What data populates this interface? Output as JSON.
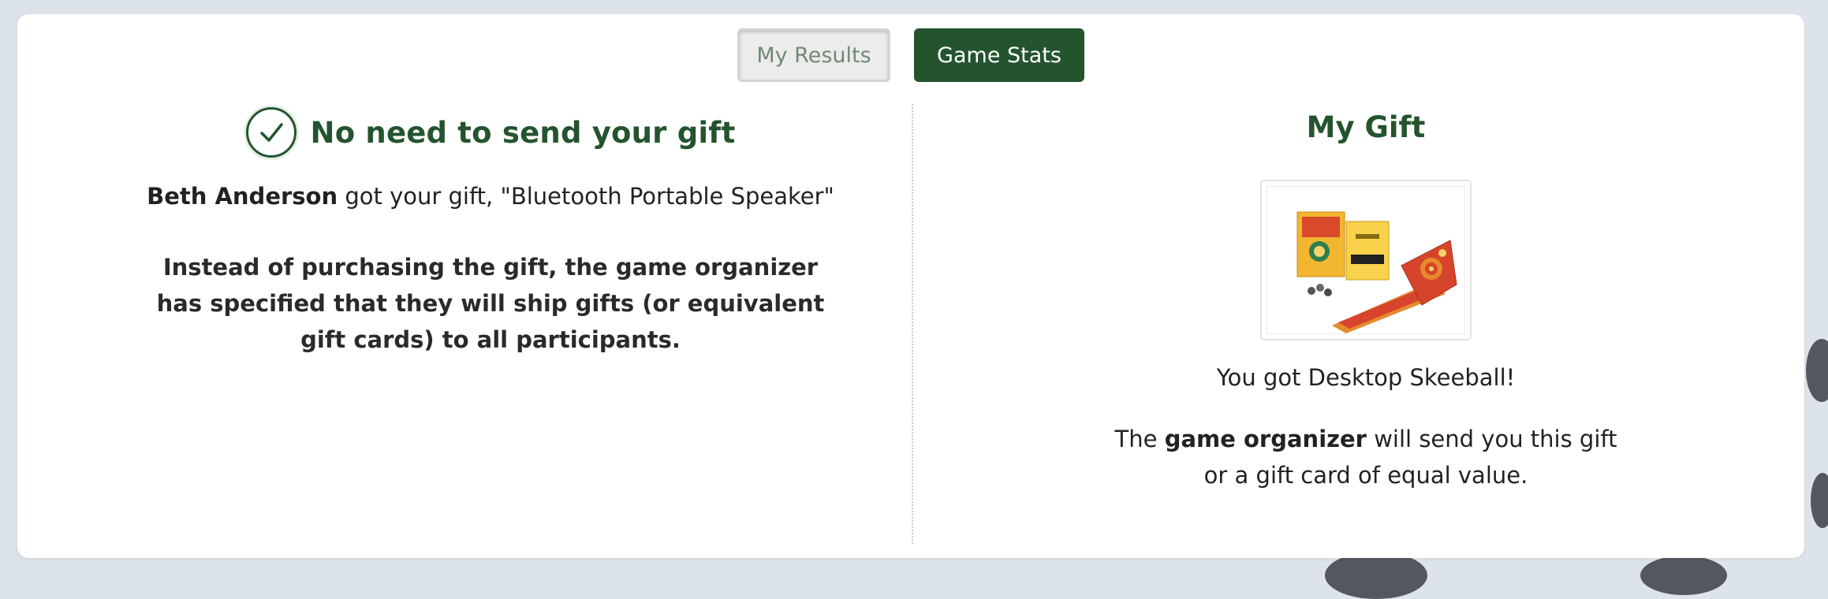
{
  "tabs": [
    {
      "label": "My Results",
      "active": true
    },
    {
      "label": "Game Stats",
      "active": false
    }
  ],
  "left": {
    "status_icon": "check-circle-icon",
    "status_title": "No need to send your gift",
    "recipient_name": "Beth Anderson",
    "got_text": " got your gift, \"Bluetooth Portable Speaker\"",
    "instead_text": "Instead of purchasing the gift, the game organizer has specified that they will ship gifts (or equivalent gift cards) to all participants."
  },
  "right": {
    "title": "My Gift",
    "gift_image": "desktop-skeeball-product-image",
    "you_got_text": "You got Desktop Skeeball!",
    "note_prefix": "The ",
    "note_bold": "game organizer",
    "note_suffix": " will send you this gift or a gift card of equal value."
  },
  "colors": {
    "accent_green": "#24542e",
    "page_background": "#dde3ea",
    "panel_background": "#ffffff"
  }
}
